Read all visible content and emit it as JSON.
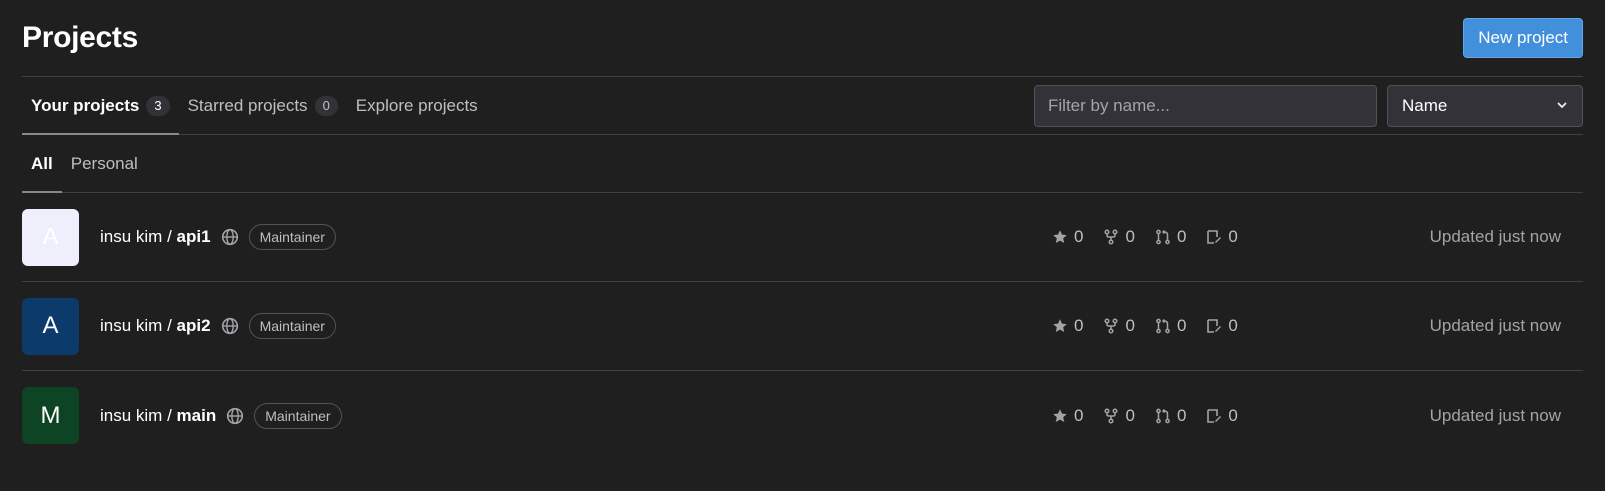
{
  "header": {
    "title": "Projects",
    "new_project_label": "New project"
  },
  "tabs": [
    {
      "label": "Your projects",
      "count": "3",
      "active": true
    },
    {
      "label": "Starred projects",
      "count": "0",
      "active": false
    },
    {
      "label": "Explore projects",
      "count": "",
      "active": false
    }
  ],
  "filter": {
    "placeholder": "Filter by name...",
    "sort_value": "Name"
  },
  "subtabs": [
    {
      "label": "All",
      "active": true
    },
    {
      "label": "Personal",
      "active": false
    }
  ],
  "projects": [
    {
      "avatar_letter": "A",
      "avatar_bg": "#eeeefc",
      "avatar_fg": "#ffffff",
      "namespace": "insu kim / ",
      "name": "api1",
      "visibility_icon": "globe-icon",
      "role": "Maintainer",
      "stars": "0",
      "forks": "0",
      "merge_requests": "0",
      "issues": "0",
      "updated": "Updated just now"
    },
    {
      "avatar_letter": "A",
      "avatar_bg": "#0b3a6b",
      "avatar_fg": "#ffffff",
      "namespace": "insu kim / ",
      "name": "api2",
      "visibility_icon": "globe-icon",
      "role": "Maintainer",
      "stars": "0",
      "forks": "0",
      "merge_requests": "0",
      "issues": "0",
      "updated": "Updated just now"
    },
    {
      "avatar_letter": "M",
      "avatar_bg": "#0d4524",
      "avatar_fg": "#ffffff",
      "namespace": "insu kim / ",
      "name": "main",
      "visibility_icon": "globe-icon",
      "role": "Maintainer",
      "stars": "0",
      "forks": "0",
      "merge_requests": "0",
      "issues": "0",
      "updated": "Updated just now"
    }
  ],
  "colors": {
    "background": "#1f1f1f",
    "primary_button": "#428fdc",
    "border": "#404040"
  }
}
